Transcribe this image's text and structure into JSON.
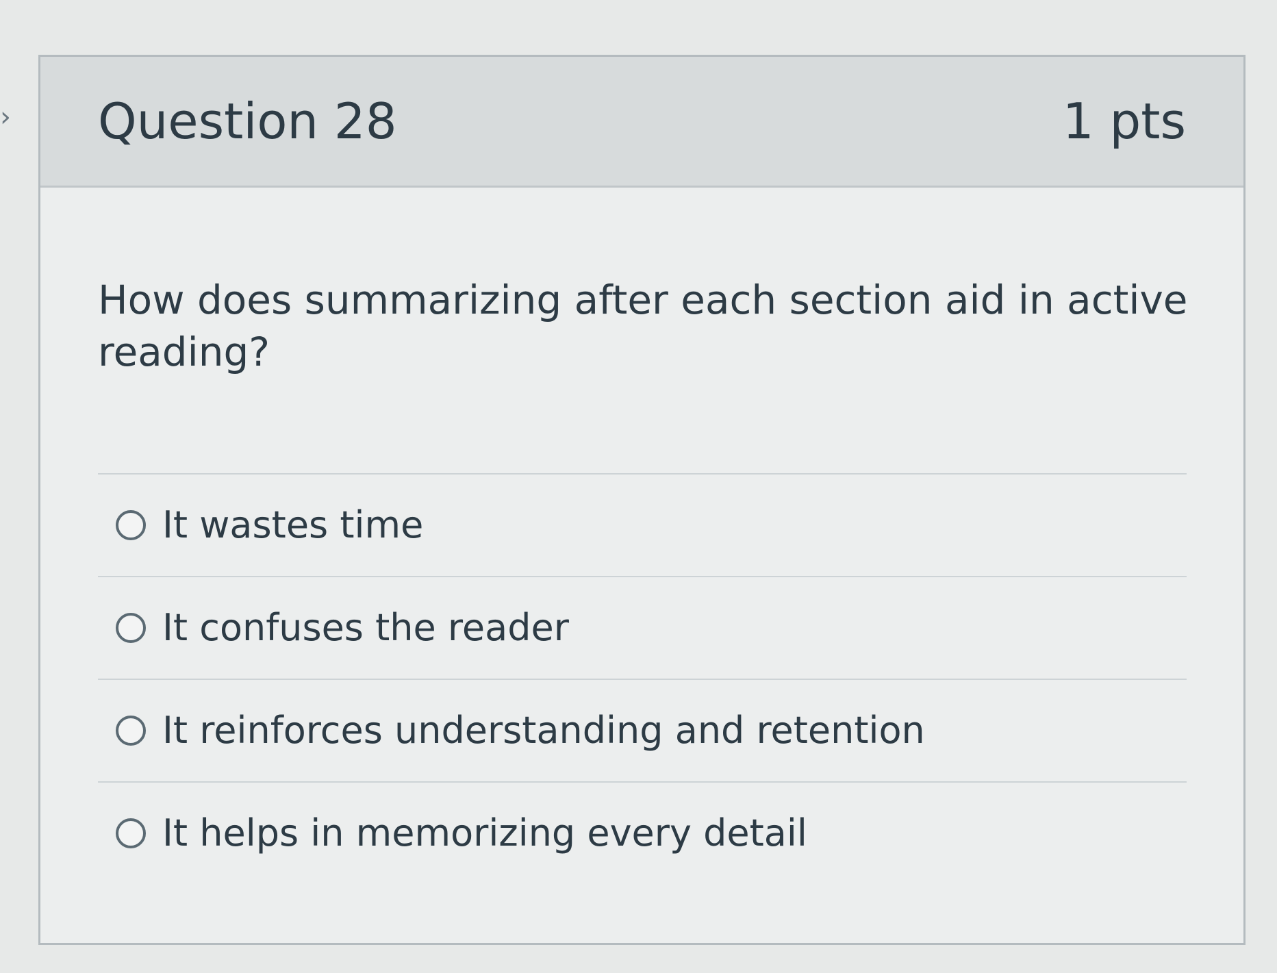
{
  "navigation": {
    "previous_icon": "chevron-right-icon",
    "previous_glyph": "›"
  },
  "question": {
    "title": "Question 28",
    "points": "1 pts",
    "prompt": "How does summarizing after each section aid in active reading?"
  },
  "answers": [
    {
      "label": "It wastes time",
      "selected": false
    },
    {
      "label": "It confuses the reader",
      "selected": false
    },
    {
      "label": "It reinforces understanding and retention",
      "selected": false
    },
    {
      "label": "It helps in memorizing every detail",
      "selected": false
    }
  ],
  "colors": {
    "text": "#2d3b45",
    "header_background": "#d7dbdc",
    "card_border": "#b4bbbf",
    "radio_border": "#5b6a73"
  }
}
